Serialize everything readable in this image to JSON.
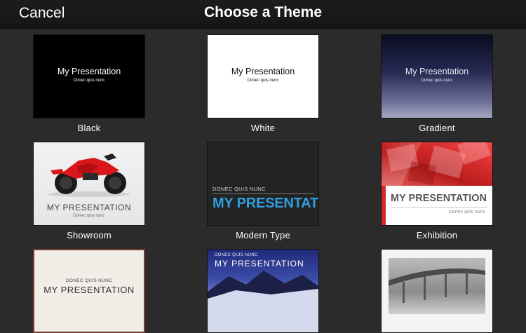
{
  "navbar": {
    "cancel_label": "Cancel",
    "title": "Choose a Theme"
  },
  "themes": [
    {
      "label": "Black",
      "title": "My Presentation",
      "subtitle": "Donec quis nunc"
    },
    {
      "label": "White",
      "title": "My Presentation",
      "subtitle": "Donec quis nunc"
    },
    {
      "label": "Gradient",
      "title": "My Presentation",
      "subtitle": "Donec quis nunc"
    },
    {
      "label": "Showroom",
      "title": "MY PRESENTATION",
      "subtitle": "Donec quis nunc"
    },
    {
      "label": "Modern Type",
      "title": "MY PRESENTATION",
      "subtitle": "DONEC QUIS NUNC"
    },
    {
      "label": "Exhibition",
      "title": "MY PRESENTATION",
      "subtitle": "Donec quis nunc"
    },
    {
      "label": "",
      "title": "MY PRESENTATION",
      "subtitle": "DONEC QUIS NUNC"
    },
    {
      "label": "",
      "title": "MY PRESENTATION",
      "subtitle": "DONEC QUIS NUNC"
    },
    {
      "label": "",
      "title": "",
      "subtitle": ""
    }
  ],
  "colors": {
    "background": "#2b2b2b",
    "navbar": "#1c1c1c",
    "modern_type_accent": "#2f9fe0",
    "exhibition_accent": "#d32b2b"
  }
}
